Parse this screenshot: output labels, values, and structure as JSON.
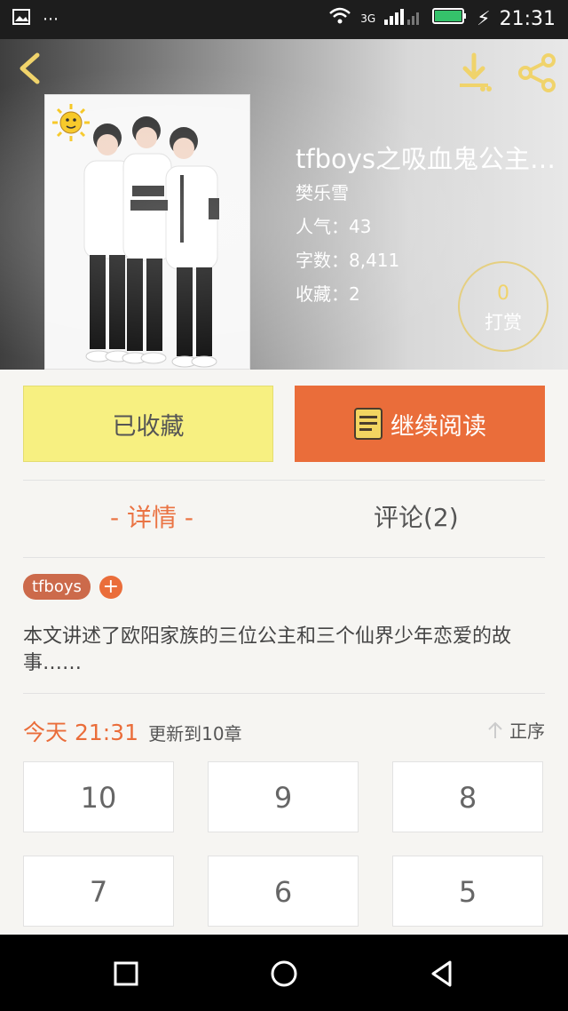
{
  "status_bar": {
    "time": "21:31",
    "network": "3G",
    "icons": [
      "image-icon",
      "more-icon",
      "wifi-icon",
      "signal-icon",
      "battery-icon",
      "charging-icon"
    ]
  },
  "header": {
    "back_icon": "back-icon",
    "download_icon": "download-icon",
    "share_icon": "share-icon"
  },
  "book": {
    "title": "tfboys之吸血鬼公主…",
    "author": "樊乐雪",
    "popularity_label": "人气：43",
    "word_count_label": "字数：8,411",
    "favorites_label": "收藏：2",
    "reward_count": "0",
    "reward_label": "打赏"
  },
  "actions": {
    "favorited": "已收藏",
    "continue_reading": "继续阅读"
  },
  "tabs": [
    {
      "label": "- 详情 -",
      "active": true
    },
    {
      "label": "评论(2)",
      "active": false
    }
  ],
  "tags": {
    "items": [
      "tfboys"
    ],
    "add_label": "+"
  },
  "description": "本文讲述了欧阳家族的三位公主和三个仙界少年恋爱的故事……",
  "update": {
    "time": "今天 21:31",
    "text": "更新到10章",
    "sort_label": "正序"
  },
  "chapters": [
    "10",
    "9",
    "8",
    "7",
    "6",
    "5"
  ],
  "colors": {
    "accent": "#ea6d3a",
    "favorite_bg": "#f7f081",
    "background": "#f6f5f2"
  }
}
